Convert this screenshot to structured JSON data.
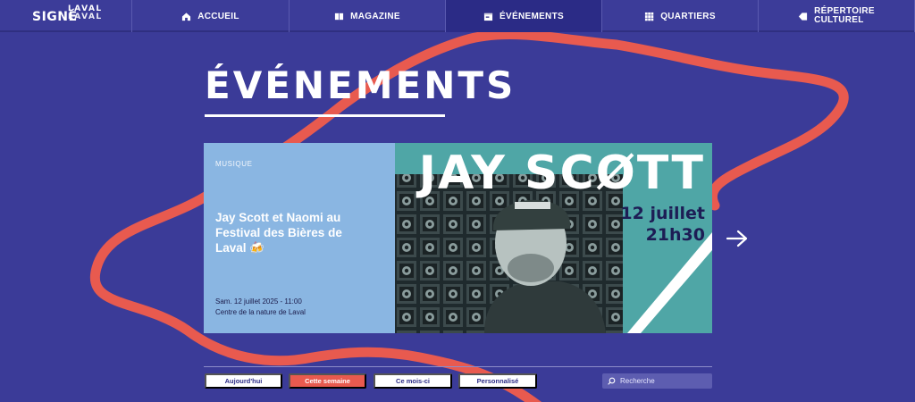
{
  "nav": {
    "logo_signe": "SIGNÉ",
    "logo_laval_top": "LAVAL",
    "logo_laval_bottom": "LAVAL",
    "items": [
      {
        "label": "ACCUEIL",
        "icon": "home-icon"
      },
      {
        "label": "MAGAZINE",
        "icon": "magazine-icon"
      },
      {
        "label": "ÉVÉNEMENTS",
        "icon": "calendar-icon",
        "active": true
      },
      {
        "label": "QUARTIERS",
        "icon": "grid-icon"
      },
      {
        "label_line1": "RÉPERTOIRE",
        "label_line2": "CULTUREL",
        "icon": "tag-icon"
      }
    ]
  },
  "page": {
    "title": "ÉVÉNEMENTS"
  },
  "event": {
    "category": "MUSIQUE",
    "headline": "Jay Scott et Naomi au Festival des Bières de Laval",
    "headline_emoji": "🍻",
    "date": "Sam. 12 juillet 2025 - 11:00",
    "venue": "Centre de la nature de Laval",
    "poster_name": "JAY SCØTT",
    "poster_date": "12 juillet",
    "poster_time": "21h30"
  },
  "filters": [
    {
      "label": "Aujourd'hui",
      "active": false
    },
    {
      "label": "Cette semaine",
      "active": true
    },
    {
      "label": "Ce mois-ci",
      "active": false
    },
    {
      "label": "Personnalisé",
      "active": false
    }
  ],
  "search": {
    "placeholder": "Recherche"
  },
  "colors": {
    "background": "#3b3b98",
    "accent_red": "#e85a4f",
    "card_blue": "#8ab6e2",
    "poster_teal": "#4fa6a6"
  }
}
